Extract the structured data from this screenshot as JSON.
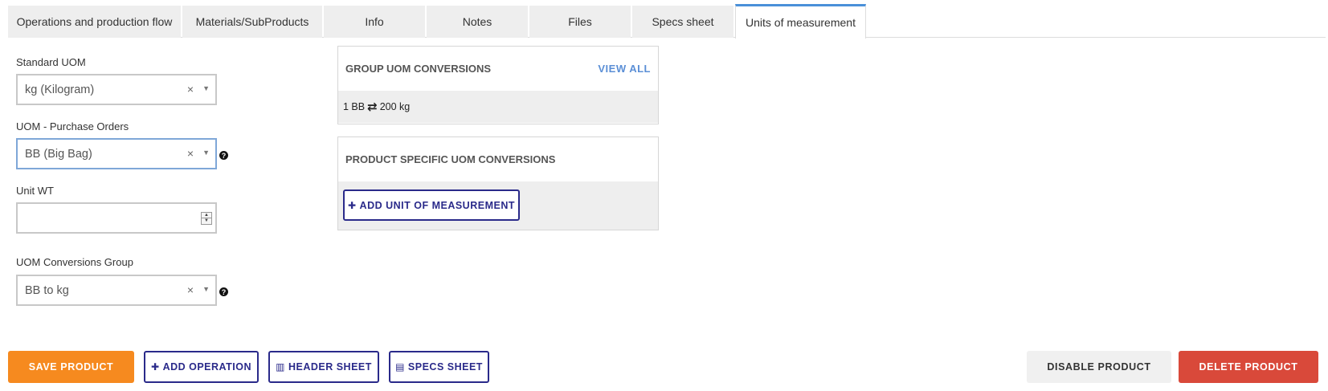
{
  "tabs": [
    {
      "label": "Operations and production flow"
    },
    {
      "label": "Materials/SubProducts"
    },
    {
      "label": "Info"
    },
    {
      "label": "Notes"
    },
    {
      "label": "Files"
    },
    {
      "label": "Specs sheet"
    },
    {
      "label": "Units of measurement",
      "active": true
    }
  ],
  "form": {
    "standard_uom": {
      "label": "Standard UOM",
      "value": "kg (Kilogram)"
    },
    "uom_purchase": {
      "label": "UOM - Purchase Orders",
      "value": "BB (Big Bag)"
    },
    "unit_wt": {
      "label": "Unit WT",
      "value": ""
    },
    "uom_group": {
      "label": "UOM Conversions Group",
      "value": "BB to kg"
    },
    "clear_glyph": "×",
    "caret_glyph": "▼",
    "help_glyph": "?"
  },
  "group_panel": {
    "title": "GROUP UOM CONVERSIONS",
    "view_all": "VIEW ALL",
    "conversion": {
      "left": "1 BB",
      "right": "200 kg"
    }
  },
  "product_panel": {
    "title": "PRODUCT SPECIFIC UOM CONVERSIONS",
    "add_button": "ADD UNIT OF MEASUREMENT"
  },
  "actions": {
    "save": "SAVE PRODUCT",
    "add_operation": "ADD OPERATION",
    "header_sheet": "HEADER SHEET",
    "specs_sheet": "SPECS SHEET",
    "disable": "DISABLE PRODUCT",
    "delete": "DELETE PRODUCT"
  },
  "colors": {
    "accent_tab": "#4a90d9",
    "save": "#f68a1f",
    "delete": "#d9493a",
    "outline": "#2a2a8a",
    "link": "#5b8fd6"
  }
}
